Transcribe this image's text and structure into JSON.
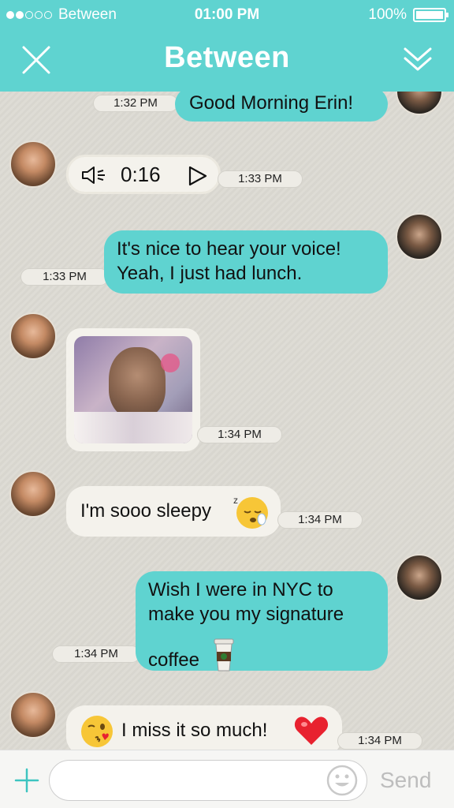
{
  "status_bar": {
    "carrier": "Between",
    "time": "01:00 PM",
    "battery": "100%",
    "signal_bars": 2
  },
  "nav": {
    "title": "Between",
    "close_icon": "close-icon",
    "more_icon": "chevron-double-down-icon"
  },
  "messages": [
    {
      "sender": "me",
      "text": "Good Morning Erin!",
      "time": "1:32 PM"
    },
    {
      "sender": "them",
      "type": "voice",
      "duration": "0:16",
      "time": "1:33 PM"
    },
    {
      "sender": "me",
      "text_line1": "It's nice to hear your voice!",
      "text_line2": "Yeah, I just had lunch.",
      "time": "1:33 PM"
    },
    {
      "sender": "them",
      "type": "photo",
      "time": "1:34 PM"
    },
    {
      "sender": "them",
      "text": "I'm sooo sleepy",
      "emoji": "sleepy-face",
      "time": "1:34 PM"
    },
    {
      "sender": "me",
      "text_line1": "Wish I were in NYC to",
      "text_line2": "make you my signature",
      "text_line3": "coffee",
      "emoji": "coffee-cup",
      "time": "1:34 PM"
    },
    {
      "sender": "them",
      "text": "I miss it so much!",
      "emoji_before": "winking-kiss-face",
      "emoji_after": "red-heart",
      "time": "1:34 PM"
    }
  ],
  "input_bar": {
    "placeholder": "",
    "send_label": "Send"
  },
  "colors": {
    "accent": "#5fd3d0",
    "incoming_bubble": "#f4f2ec",
    "heart": "#e8222f"
  }
}
